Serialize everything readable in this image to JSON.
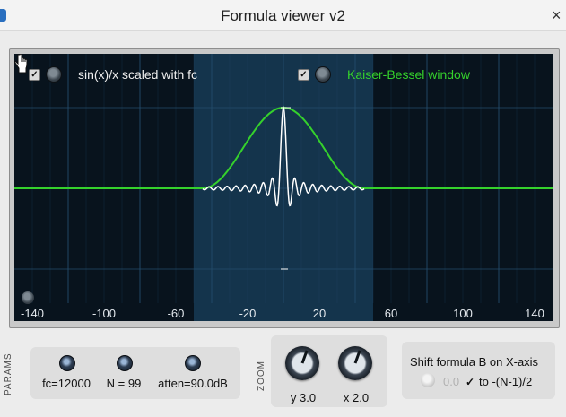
{
  "window": {
    "title": "Formula viewer v2"
  },
  "plot": {
    "formula_a": {
      "checked": true,
      "label": "sin(x)/x scaled with fc"
    },
    "formula_b": {
      "checked": true,
      "label": "Kaiser-Bessel window"
    },
    "colors": {
      "background": "#08131d",
      "highlight": "#14344c",
      "grid": "#234c6b",
      "formula_a": "#ffffff",
      "formula_b": "#35d12c"
    }
  },
  "chart_data": {
    "type": "line",
    "xlim": [
      -150,
      150
    ],
    "x_ticks": [
      "-140",
      "-100",
      "-60",
      "-20",
      "20",
      "60",
      "100",
      "140"
    ],
    "series": [
      {
        "name": "sin(x)/x scaled with fc",
        "color": "#ffffff"
      },
      {
        "name": "Kaiser-Bessel window",
        "color": "#35d12c"
      }
    ]
  },
  "params": {
    "section_label": "PARAMS",
    "fc": "fc=12000",
    "n": "N = 99",
    "atten": "atten=90.0dB"
  },
  "zoom": {
    "section_label": "ZOOM",
    "y": "y 3.0",
    "x": "x 2.0"
  },
  "shift": {
    "title": "Shift formula B on X-axis",
    "value": "0.0",
    "checked": true,
    "label": "to -(N-1)/2"
  }
}
